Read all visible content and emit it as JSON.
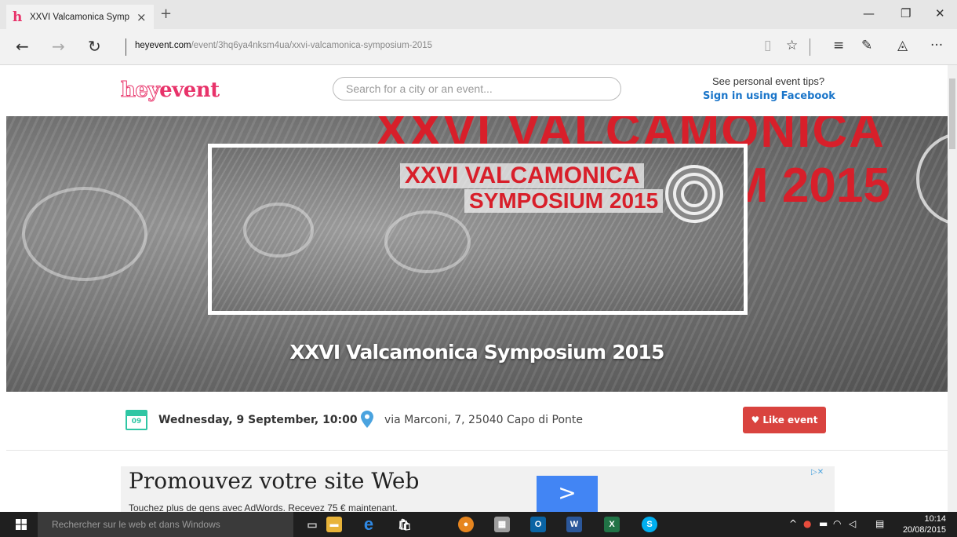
{
  "browser": {
    "tab_title": "XXVI Valcamonica Symp",
    "tab_close": "×",
    "new_tab": "+",
    "favicon": "h",
    "url_host": "heyevent.com",
    "url_path": "/event/3hq6ya4nksm4ua/xxvi-valcamonica-symposium-2015",
    "icons": [
      "back-icon",
      "forward-icon",
      "refresh-icon",
      "reading-view-icon",
      "favorite-star-icon",
      "hub-icon",
      "web-note-icon",
      "share-icon",
      "more-icon"
    ]
  },
  "header": {
    "logo_hey": "hey",
    "logo_event": "event",
    "search_placeholder": "Search for a city or an event...",
    "tips_text": "See personal event tips?",
    "facebook_link": "Sign in using Facebook"
  },
  "hero": {
    "banner_line1": "XXVI VALCAMONICA",
    "banner_line2": "SYMPOSIUM 2015",
    "bg_text1": "XXVI VALCAMONICA",
    "bg_text2": "M 2015",
    "title": "XXVI Valcamonica Symposium 2015"
  },
  "event": {
    "calendar_day": "09",
    "date": "Wednesday, 9 September, 10:00",
    "address": "via Marconi, 7, 25040 Capo di Ponte",
    "like_label": "Like event"
  },
  "ad": {
    "headline": "Promouvez votre site Web",
    "subline": "Touchez plus de gens avec AdWords. Recevez 75 € maintenant.",
    "button_symbol": ">",
    "adchoices": "▷✕"
  },
  "taskbar": {
    "search_placeholder": "Rechercher sur le web et dans Windows",
    "time": "10:14",
    "date": "20/08/2015"
  },
  "colors": {
    "brand_pink": "#e8336a",
    "facebook_blue": "#1a75c9",
    "like_red": "#d9433f",
    "calendar_teal": "#2fc6a4",
    "pin_blue": "#4aa3df"
  }
}
